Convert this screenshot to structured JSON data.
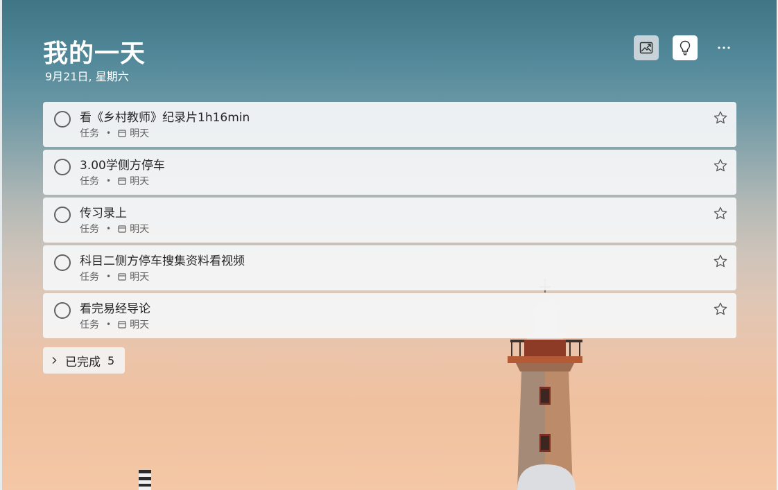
{
  "header": {
    "title": "我的一天",
    "date": "9月21日, 星期六"
  },
  "toolbar": {
    "background_icon": "image-background-icon",
    "suggestions_icon": "lightbulb-icon",
    "more_label": "···"
  },
  "tasks": [
    {
      "title": "看《乡村教师》纪录片1h16min",
      "list": "任务",
      "due": "明天"
    },
    {
      "title": "3.00学侧方停车",
      "list": "任务",
      "due": "明天"
    },
    {
      "title": "传习录上",
      "list": "任务",
      "due": "明天"
    },
    {
      "title": "科目二侧方停车搜集资料看视频",
      "list": "任务",
      "due": "明天"
    },
    {
      "title": "看完易经导论",
      "list": "任务",
      "due": "明天"
    }
  ],
  "completed": {
    "label": "已完成",
    "count": "5"
  },
  "colors": {
    "accent": "#2564cf",
    "task_card": "#f4f5f6",
    "sky_top": "#3f7584",
    "sky_bottom": "#f4c7a6"
  }
}
